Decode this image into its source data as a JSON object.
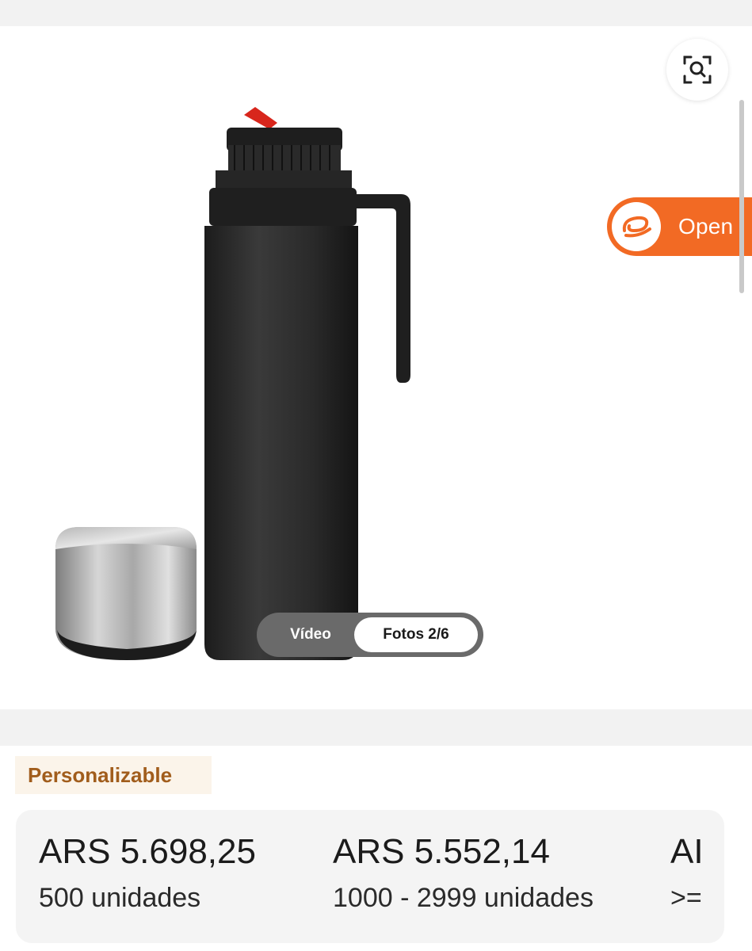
{
  "gallery": {
    "open_button_label": "Open",
    "media_tabs": [
      {
        "label": "Vídeo",
        "active": false
      },
      {
        "label": "Fotos 2/6",
        "active": true
      }
    ],
    "icons": {
      "image_search": "image-search-icon",
      "app_logo": "alibaba-logo-icon"
    },
    "accent_color": "#f26a24"
  },
  "product": {
    "tag": "Personalizable",
    "price_tiers": [
      {
        "price": "ARS 5.698,25",
        "quantity": "500 unidades"
      },
      {
        "price": "ARS 5.552,14",
        "quantity": "1000 - 2999 unidades"
      },
      {
        "price": "AI",
        "quantity": ">="
      }
    ]
  }
}
